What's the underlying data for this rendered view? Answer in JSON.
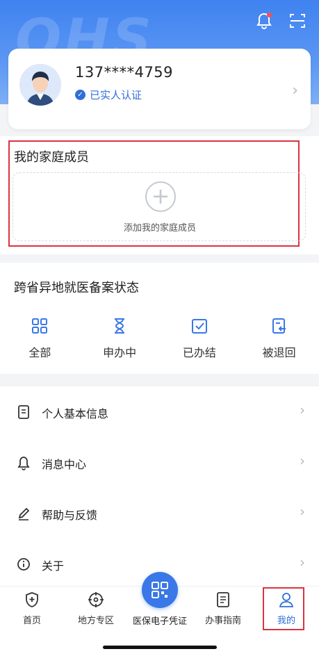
{
  "header": {
    "watermark": "QHS",
    "icons": [
      "bell-icon",
      "scan-icon"
    ]
  },
  "profile": {
    "phone": "137****4759",
    "verified_label": "已实人认证"
  },
  "family": {
    "title": "我的家庭成员",
    "add_label": "添加我的家庭成员"
  },
  "filing_status": {
    "title": "跨省异地就医备案状态",
    "items": [
      {
        "label": "全部",
        "icon": "grid-icon"
      },
      {
        "label": "申办中",
        "icon": "hourglass-icon"
      },
      {
        "label": "已办结",
        "icon": "checkbox-icon"
      },
      {
        "label": "被退回",
        "icon": "return-doc-icon"
      }
    ]
  },
  "menu": [
    {
      "label": "个人基本信息",
      "icon": "document-icon"
    },
    {
      "label": "消息中心",
      "icon": "bell-icon"
    },
    {
      "label": "帮助与反馈",
      "icon": "pen-icon"
    },
    {
      "label": "关于",
      "icon": "info-icon"
    }
  ],
  "tabbar": {
    "tabs": [
      {
        "label": "首页",
        "icon": "shield-plus-icon"
      },
      {
        "label": "地方专区",
        "icon": "target-icon"
      },
      {
        "label": "医保电子凭证",
        "icon": "qr-code-icon"
      },
      {
        "label": "办事指南",
        "icon": "guide-doc-icon"
      },
      {
        "label": "我的",
        "icon": "user-icon"
      }
    ],
    "active": "我的"
  },
  "colors": {
    "brand_blue": "#3978e6",
    "highlight_red": "#d9333f"
  }
}
